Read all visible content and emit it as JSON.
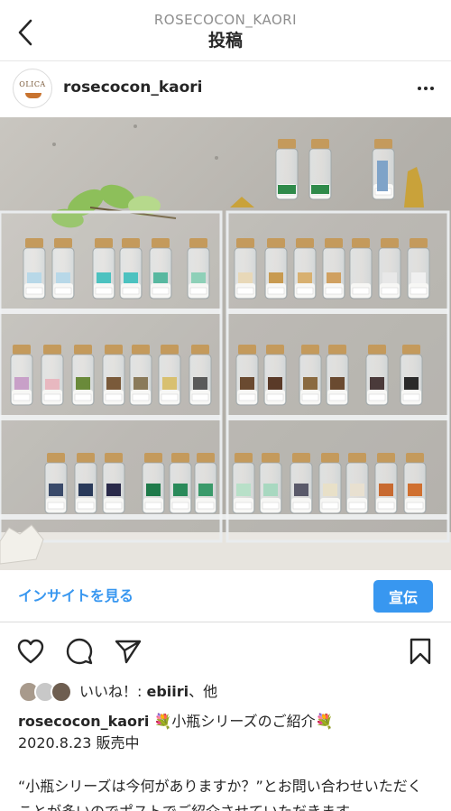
{
  "header": {
    "account": "ROSECOCON_KAORI",
    "title": "投稿"
  },
  "post": {
    "avatar_text": "OLICA",
    "username": "rosecocon_kaori"
  },
  "insight": {
    "link_label": "インサイトを見る",
    "promote_label": "宣伝"
  },
  "likes": {
    "prefix": "いいね！: ",
    "user": "ebiiri",
    "suffix": "、他"
  },
  "caption": {
    "username": "rosecocon_kaori",
    "text": "💐小瓶シリーズのご紹介💐",
    "line2": "2020.8.23 販売中",
    "body": "“小瓶シリーズは今何がありますか？”とお問い合わせいただくことが多いのでポストでご紹介させていただきます"
  },
  "icons": {
    "back": "chevron-left-icon",
    "more": "more-horizontal-icon",
    "like": "heart-icon",
    "comment": "comment-icon",
    "share": "send-icon",
    "save": "bookmark-icon"
  },
  "colors": {
    "accent": "#3897f0",
    "text": "#262626",
    "muted": "#8e8e8e"
  }
}
